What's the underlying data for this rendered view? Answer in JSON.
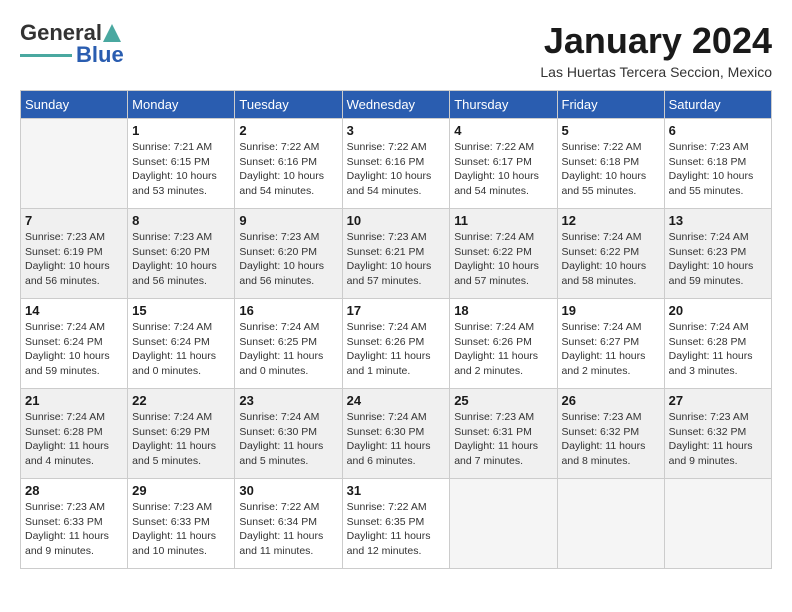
{
  "logo": {
    "general": "General",
    "blue": "Blue"
  },
  "title": "January 2024",
  "location": "Las Huertas Tercera Seccion, Mexico",
  "days_of_week": [
    "Sunday",
    "Monday",
    "Tuesday",
    "Wednesday",
    "Thursday",
    "Friday",
    "Saturday"
  ],
  "weeks": [
    [
      {
        "day": "",
        "info": ""
      },
      {
        "day": "1",
        "info": "Sunrise: 7:21 AM\nSunset: 6:15 PM\nDaylight: 10 hours\nand 53 minutes."
      },
      {
        "day": "2",
        "info": "Sunrise: 7:22 AM\nSunset: 6:16 PM\nDaylight: 10 hours\nand 54 minutes."
      },
      {
        "day": "3",
        "info": "Sunrise: 7:22 AM\nSunset: 6:16 PM\nDaylight: 10 hours\nand 54 minutes."
      },
      {
        "day": "4",
        "info": "Sunrise: 7:22 AM\nSunset: 6:17 PM\nDaylight: 10 hours\nand 54 minutes."
      },
      {
        "day": "5",
        "info": "Sunrise: 7:22 AM\nSunset: 6:18 PM\nDaylight: 10 hours\nand 55 minutes."
      },
      {
        "day": "6",
        "info": "Sunrise: 7:23 AM\nSunset: 6:18 PM\nDaylight: 10 hours\nand 55 minutes."
      }
    ],
    [
      {
        "day": "7",
        "info": "Sunrise: 7:23 AM\nSunset: 6:19 PM\nDaylight: 10 hours\nand 56 minutes."
      },
      {
        "day": "8",
        "info": "Sunrise: 7:23 AM\nSunset: 6:20 PM\nDaylight: 10 hours\nand 56 minutes."
      },
      {
        "day": "9",
        "info": "Sunrise: 7:23 AM\nSunset: 6:20 PM\nDaylight: 10 hours\nand 56 minutes."
      },
      {
        "day": "10",
        "info": "Sunrise: 7:23 AM\nSunset: 6:21 PM\nDaylight: 10 hours\nand 57 minutes."
      },
      {
        "day": "11",
        "info": "Sunrise: 7:24 AM\nSunset: 6:22 PM\nDaylight: 10 hours\nand 57 minutes."
      },
      {
        "day": "12",
        "info": "Sunrise: 7:24 AM\nSunset: 6:22 PM\nDaylight: 10 hours\nand 58 minutes."
      },
      {
        "day": "13",
        "info": "Sunrise: 7:24 AM\nSunset: 6:23 PM\nDaylight: 10 hours\nand 59 minutes."
      }
    ],
    [
      {
        "day": "14",
        "info": "Sunrise: 7:24 AM\nSunset: 6:24 PM\nDaylight: 10 hours\nand 59 minutes."
      },
      {
        "day": "15",
        "info": "Sunrise: 7:24 AM\nSunset: 6:24 PM\nDaylight: 11 hours\nand 0 minutes."
      },
      {
        "day": "16",
        "info": "Sunrise: 7:24 AM\nSunset: 6:25 PM\nDaylight: 11 hours\nand 0 minutes."
      },
      {
        "day": "17",
        "info": "Sunrise: 7:24 AM\nSunset: 6:26 PM\nDaylight: 11 hours\nand 1 minute."
      },
      {
        "day": "18",
        "info": "Sunrise: 7:24 AM\nSunset: 6:26 PM\nDaylight: 11 hours\nand 2 minutes."
      },
      {
        "day": "19",
        "info": "Sunrise: 7:24 AM\nSunset: 6:27 PM\nDaylight: 11 hours\nand 2 minutes."
      },
      {
        "day": "20",
        "info": "Sunrise: 7:24 AM\nSunset: 6:28 PM\nDaylight: 11 hours\nand 3 minutes."
      }
    ],
    [
      {
        "day": "21",
        "info": "Sunrise: 7:24 AM\nSunset: 6:28 PM\nDaylight: 11 hours\nand 4 minutes."
      },
      {
        "day": "22",
        "info": "Sunrise: 7:24 AM\nSunset: 6:29 PM\nDaylight: 11 hours\nand 5 minutes."
      },
      {
        "day": "23",
        "info": "Sunrise: 7:24 AM\nSunset: 6:30 PM\nDaylight: 11 hours\nand 5 minutes."
      },
      {
        "day": "24",
        "info": "Sunrise: 7:24 AM\nSunset: 6:30 PM\nDaylight: 11 hours\nand 6 minutes."
      },
      {
        "day": "25",
        "info": "Sunrise: 7:23 AM\nSunset: 6:31 PM\nDaylight: 11 hours\nand 7 minutes."
      },
      {
        "day": "26",
        "info": "Sunrise: 7:23 AM\nSunset: 6:32 PM\nDaylight: 11 hours\nand 8 minutes."
      },
      {
        "day": "27",
        "info": "Sunrise: 7:23 AM\nSunset: 6:32 PM\nDaylight: 11 hours\nand 9 minutes."
      }
    ],
    [
      {
        "day": "28",
        "info": "Sunrise: 7:23 AM\nSunset: 6:33 PM\nDaylight: 11 hours\nand 9 minutes."
      },
      {
        "day": "29",
        "info": "Sunrise: 7:23 AM\nSunset: 6:33 PM\nDaylight: 11 hours\nand 10 minutes."
      },
      {
        "day": "30",
        "info": "Sunrise: 7:22 AM\nSunset: 6:34 PM\nDaylight: 11 hours\nand 11 minutes."
      },
      {
        "day": "31",
        "info": "Sunrise: 7:22 AM\nSunset: 6:35 PM\nDaylight: 11 hours\nand 12 minutes."
      },
      {
        "day": "",
        "info": ""
      },
      {
        "day": "",
        "info": ""
      },
      {
        "day": "",
        "info": ""
      }
    ]
  ]
}
